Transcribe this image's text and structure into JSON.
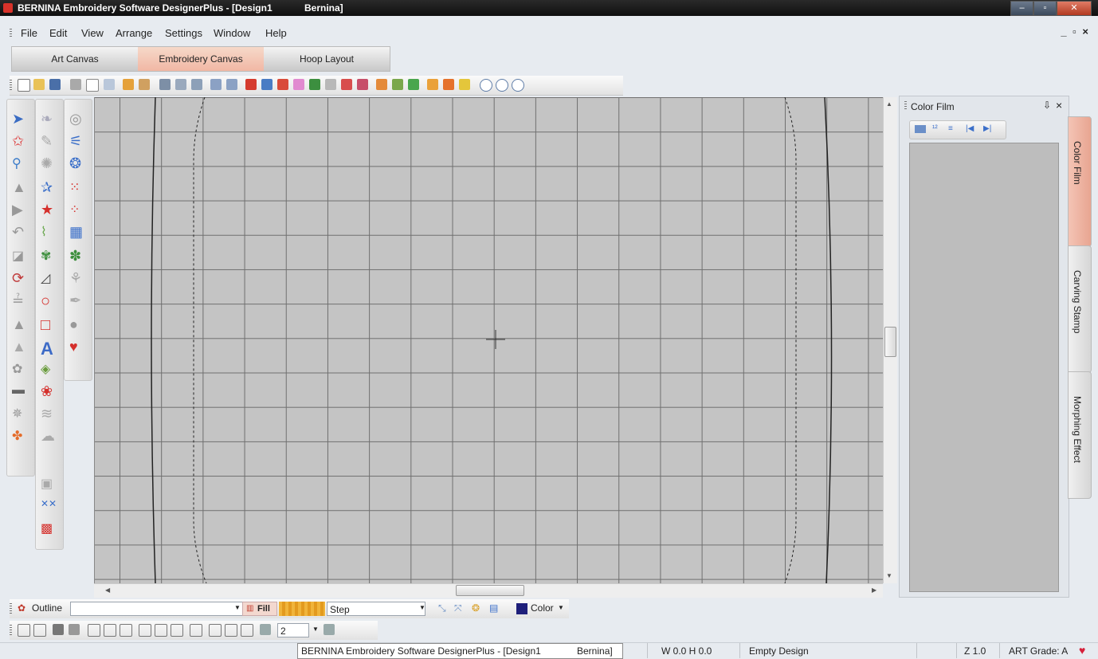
{
  "window": {
    "title_main": "BERNINA Embroidery Software DesignerPlus - [Design1",
    "title_doc": "Bernina]",
    "mdi_controls": "_ ▫ ×"
  },
  "menu": [
    "File",
    "Edit",
    "View",
    "Arrange",
    "Settings",
    "Window",
    "Help"
  ],
  "canvas_tabs": [
    {
      "label": "Art Canvas",
      "active": false
    },
    {
      "label": "Embroidery Canvas",
      "active": true
    },
    {
      "label": "Hoop Layout",
      "active": false
    }
  ],
  "panel": {
    "title": "Color Film",
    "pin": "⇩",
    "close": "×",
    "tabs": [
      "Color Film",
      "Carving Stamp",
      "Morphing Effect"
    ]
  },
  "propbar": {
    "outline_label": "Outline",
    "outline_value": "",
    "fill_label": "Fill",
    "fill_value": "Step",
    "color_label": "Color"
  },
  "alignbar": {
    "spin_value": "2"
  },
  "status": {
    "tooltip": "BERNINA Embroidery Software DesignerPlus - [Design1",
    "tooltip_doc": "Bernina]",
    "size": "W  0.0 H  0.0",
    "design": "Empty Design",
    "zoom": "Z 1.0",
    "grade": "ART Grade: A"
  },
  "colors": {
    "accent_tab": "#f1b7a4",
    "canvas_bg": "#c4c4c4",
    "grid": "#6f6f6f",
    "color_swatch": "#1e1f7a",
    "heart": "#d6203a"
  }
}
